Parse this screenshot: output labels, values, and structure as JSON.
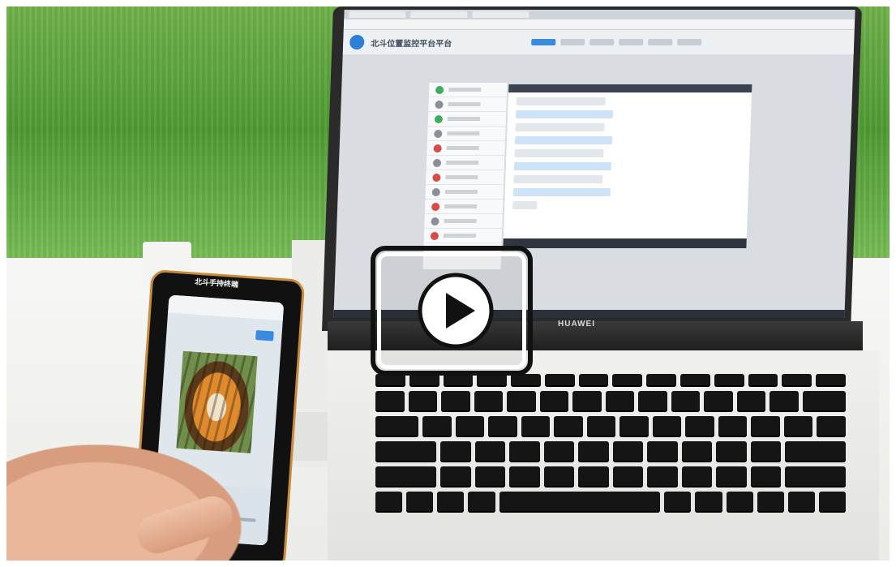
{
  "video": {
    "play_icon": "play-icon",
    "overlay_color": "#111111",
    "overlay_accent": "#ffffff"
  },
  "phone": {
    "top_label": "北斗手持终端"
  },
  "laptop": {
    "brand": "HUAWEI",
    "screen": {
      "app_title": "北斗位置监控平台平台"
    }
  }
}
